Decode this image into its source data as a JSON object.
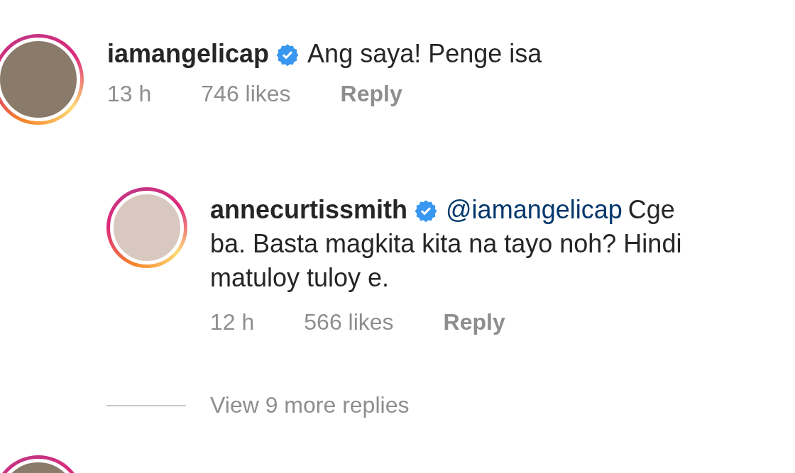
{
  "comments": [
    {
      "username": "iamangelicap",
      "verified": true,
      "text": "Ang saya! Penge isa",
      "time": "13 h",
      "likes": "746 likes",
      "reply_label": "Reply",
      "replies": [
        {
          "username": "annecurtissmith",
          "verified": true,
          "mention": "@iamangelicap",
          "text": "Cge ba. Basta magkita kita na tayo noh? Hindi matuloy tuloy e.",
          "time": "12 h",
          "likes": "566 likes",
          "reply_label": "Reply"
        }
      ],
      "view_replies": "View 9 more replies"
    }
  ]
}
